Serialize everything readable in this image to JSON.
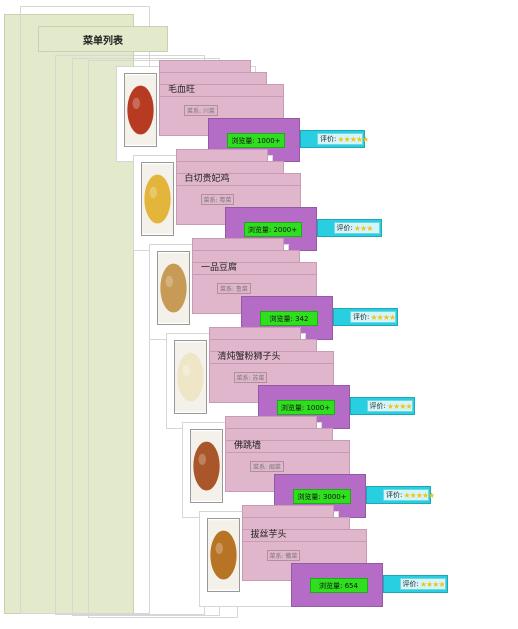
{
  "page": {
    "title": "菜单列表"
  },
  "menu": {
    "items": [
      {
        "name": "毛血旺",
        "cuisine": "菜系: 川菜",
        "views_label": "浏览量:",
        "views": "1000+",
        "rating_label": "评价:",
        "stars": "★★★★★",
        "plate_color": "#b63b22"
      },
      {
        "name": "白切贵妃鸡",
        "cuisine": "菜系: 粤菜",
        "views_label": "浏览量:",
        "views": "2000+",
        "rating_label": "评价:",
        "stars": "★★★",
        "plate_color": "#e4b53b"
      },
      {
        "name": "一品豆腐",
        "cuisine": "菜系: 鲁菜",
        "views_label": "浏览量:",
        "views": "342",
        "rating_label": "评价:",
        "stars": "★★★★",
        "plate_color": "#c79a55"
      },
      {
        "name": "清炖蟹粉狮子头",
        "cuisine": "菜系: 苏菜",
        "views_label": "浏览量:",
        "views": "1000+",
        "rating_label": "评价:",
        "stars": "★★★★",
        "plate_color": "#efe6c8"
      },
      {
        "name": "佛跳墙",
        "cuisine": "菜系: 闽菜",
        "views_label": "浏览量:",
        "views": "3000+",
        "rating_label": "评价:",
        "stars": "★★★★★",
        "plate_color": "#a8562a"
      },
      {
        "name": "拔丝芋头",
        "cuisine": "菜系: 徽菜",
        "views_label": "浏览量:",
        "views": "654",
        "rating_label": "评价:",
        "stars": "★★★★",
        "plate_color": "#b77424"
      }
    ]
  }
}
